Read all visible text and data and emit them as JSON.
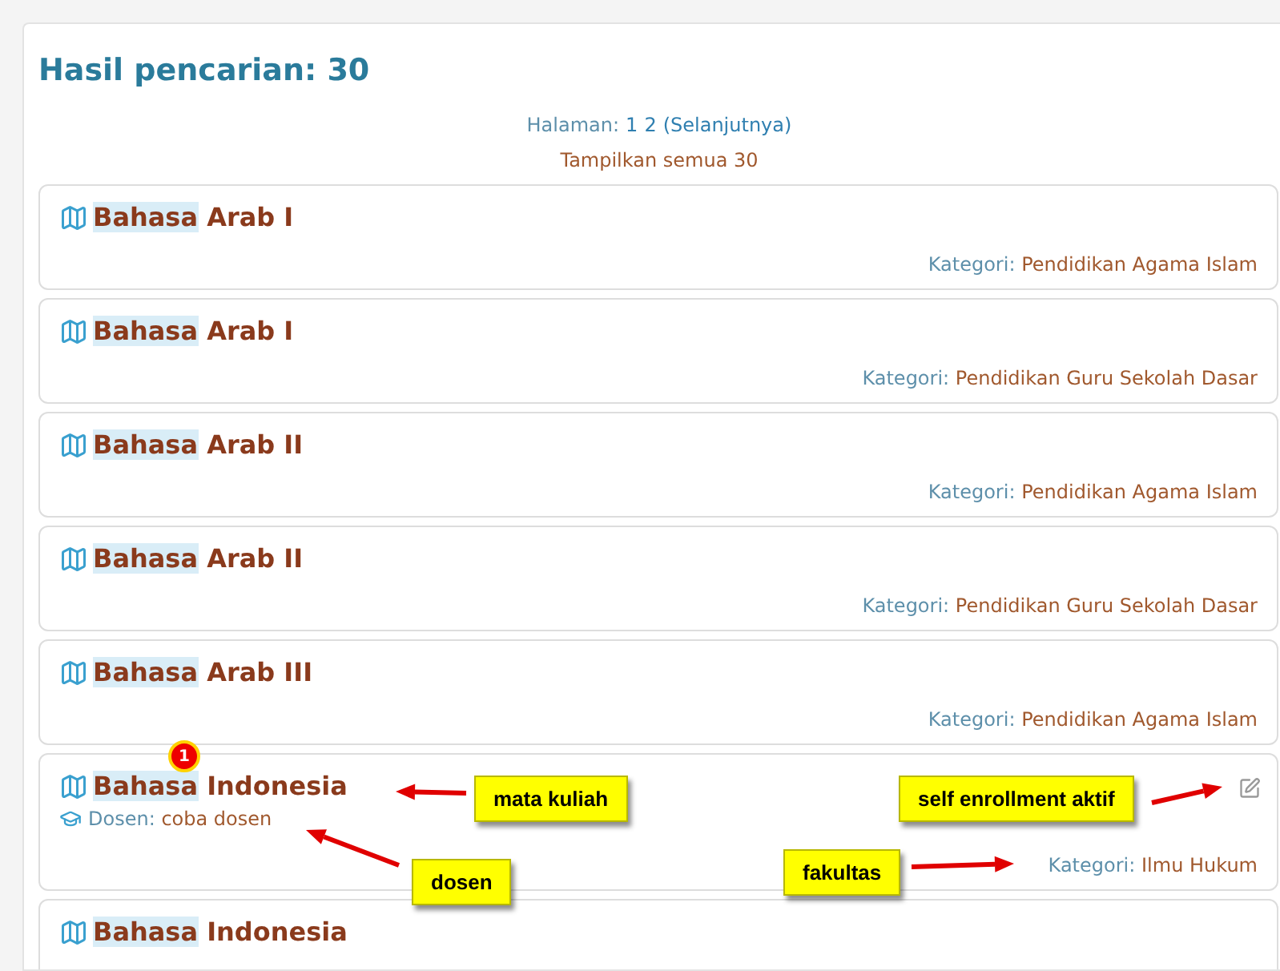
{
  "heading": "Hasil pencarian: 30",
  "paging": {
    "label": "Halaman:",
    "pages": [
      "1",
      "2"
    ],
    "next": "(Selanjutnya)"
  },
  "show_all": "Tampilkan semua 30",
  "courses": [
    {
      "highlight": "Bahasa",
      "rest": "Arab I",
      "category_label": "Kategori:",
      "category": "Pendidikan Agama Islam"
    },
    {
      "highlight": "Bahasa",
      "rest": "Arab I",
      "category_label": "Kategori:",
      "category": "Pendidikan Guru Sekolah Dasar"
    },
    {
      "highlight": "Bahasa",
      "rest": "Arab II",
      "category_label": "Kategori:",
      "category": "Pendidikan Agama Islam"
    },
    {
      "highlight": "Bahasa",
      "rest": "Arab II",
      "category_label": "Kategori:",
      "category": "Pendidikan Guru Sekolah Dasar"
    },
    {
      "highlight": "Bahasa",
      "rest": "Arab III",
      "category_label": "Kategori:",
      "category": "Pendidikan Agama Islam"
    },
    {
      "highlight": "Bahasa",
      "rest": "Indonesia",
      "teacher_label": "Dosen:",
      "teacher": "coba dosen",
      "self_enrol": true,
      "category_label": "Kategori:",
      "category": "Ilmu Hukum",
      "marker": "1",
      "callouts": [
        {
          "text": "mata kuliah"
        },
        {
          "text": "dosen"
        },
        {
          "text": "self enrollment aktif"
        },
        {
          "text": "fakultas"
        }
      ]
    },
    {
      "highlight": "Bahasa",
      "rest": "Indonesia"
    }
  ]
}
